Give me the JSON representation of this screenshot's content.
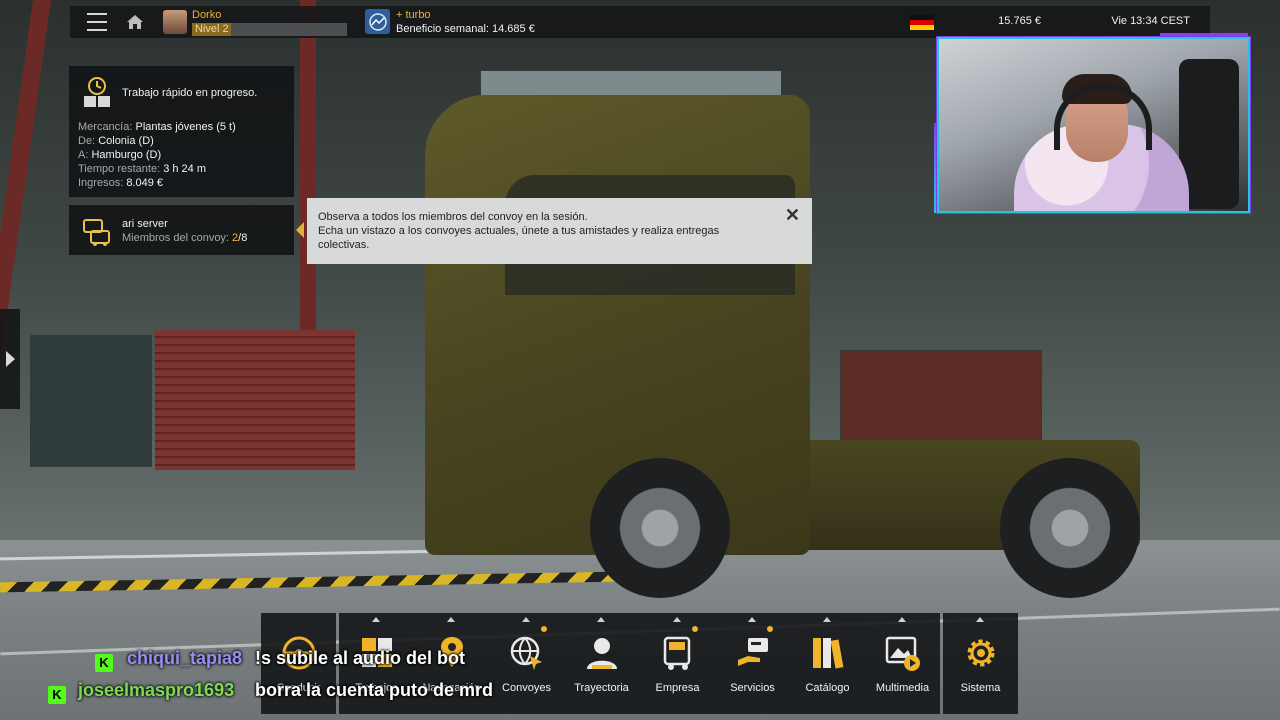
{
  "topbar": {
    "player_name": "Dorko",
    "player_level": "Nivel 2",
    "level_progress": 0.25,
    "company_name": "+ turbo",
    "weekly_profit": "Beneficio semanal: 14.685 €",
    "money": "15.765 €",
    "datetime": "Vie 13:34 CEST",
    "country_flag": "germany-flag"
  },
  "job": {
    "status": "Trabajo rápido en progreso.",
    "cargo_label": "Mercancía:",
    "cargo_value": "Plantas jóvenes (5 t)",
    "from_label": "De:",
    "from_value": "Colonia (D)",
    "to_label": "A:",
    "to_value": "Hamburgo (D)",
    "time_label": "Tiempo restante:",
    "time_value": "3 h 24 m",
    "income_label": "Ingresos:",
    "income_value": "8.049 €"
  },
  "convoy": {
    "server_name": "ari server",
    "members_label": "Miembros del convoy: ",
    "members_count": "2",
    "members_total": "/8"
  },
  "tooltip": {
    "line1": "Observa a todos los miembros del convoy en la sesión.",
    "line2": "Echa un vistazo a los convoyes actuales, únete a tus amistades y realiza entregas colectivas.",
    "close": "✕"
  },
  "menu": {
    "items": [
      {
        "label": "Conducir",
        "icon": "steering-wheel-icon"
      },
      {
        "label": "Trabajos",
        "icon": "cargo-boxes-icon"
      },
      {
        "label": "Navegación",
        "icon": "map-pin-icon"
      },
      {
        "label": "Convoyes",
        "icon": "globe-cursor-icon"
      },
      {
        "label": "Trayectoria",
        "icon": "driver-profile-icon"
      },
      {
        "label": "Empresa",
        "icon": "company-truck-icon"
      },
      {
        "label": "Servicios",
        "icon": "services-hand-icon"
      },
      {
        "label": "Catálogo",
        "icon": "catalog-books-icon"
      },
      {
        "label": "Multimedia",
        "icon": "multimedia-icon"
      },
      {
        "label": "Sistema",
        "icon": "gear-icon"
      }
    ]
  },
  "chat": [
    {
      "user": "chiqui_tapia8",
      "user_color": "#9b8cf2",
      "message": "!s subile al audio del bot"
    },
    {
      "user": "joseelmaspro1693",
      "user_color": "#7ed957",
      "message": "borra la cuenta puto de mrd"
    }
  ],
  "colors": {
    "accent": "#f0b42a",
    "kick_green": "#53fc18",
    "webcam_border": "#26c6da",
    "webcam_glow": "#8a3cf0"
  }
}
